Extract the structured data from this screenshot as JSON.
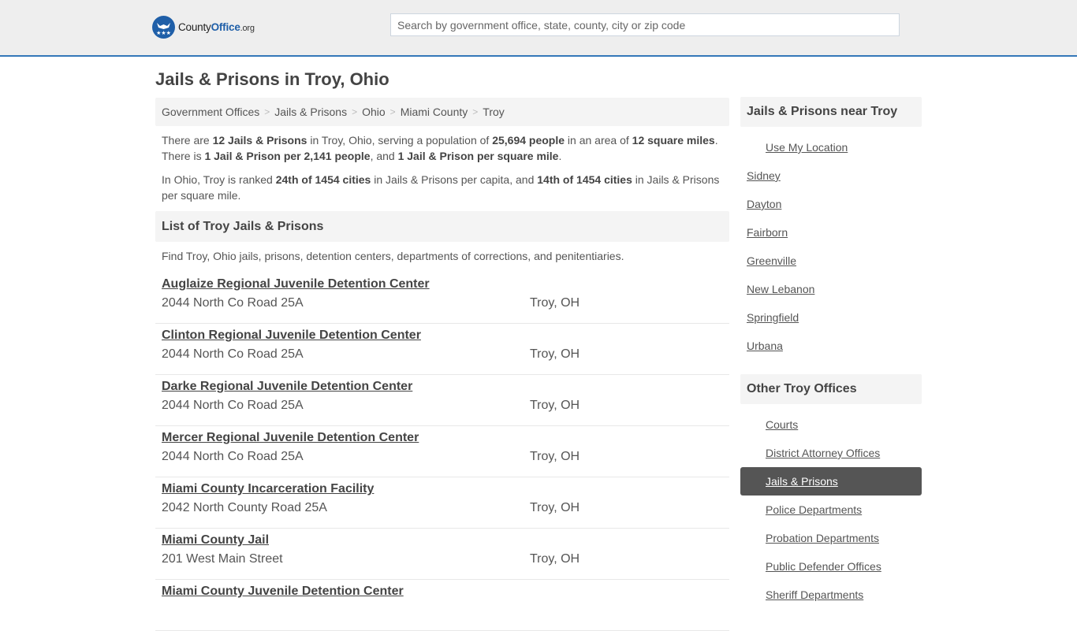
{
  "header": {
    "logo": {
      "name": "County",
      "office": "Office",
      "tld": ".org"
    },
    "search_placeholder": "Search by government office, state, county, city or zip code",
    "accent_color": "#3477b8"
  },
  "page_title": "Jails & Prisons in Troy, Ohio",
  "breadcrumb": [
    "Government Offices",
    "Jails & Prisons",
    "Ohio",
    "Miami County",
    "Troy"
  ],
  "breadcrumb_separator": ">",
  "intro": {
    "p1": {
      "t1": "There are ",
      "b1": "12 Jails & Prisons",
      "t2": " in Troy, Ohio, serving a population of ",
      "b2": "25,694 people",
      "t3": " in an area of ",
      "b3": "12 square miles",
      "t4": ". There is ",
      "b4": "1 Jail & Prison per 2,141 people",
      "t5": ", and ",
      "b5": "1 Jail & Prison per square mile",
      "t6": "."
    },
    "p2": {
      "t1": "In Ohio, Troy is ranked ",
      "b1": "24th of 1454 cities",
      "t2": " in Jails & Prisons per capita, and ",
      "b2": "14th of 1454 cities",
      "t3": " in Jails & Prisons per square mile."
    }
  },
  "list_section": {
    "title": "List of Troy Jails & Prisons",
    "description": "Find Troy, Ohio jails, prisons, detention centers, departments of corrections, and penitentiaries.",
    "items": [
      {
        "name": "Auglaize Regional Juvenile Detention Center",
        "address": "2044 North Co Road 25A",
        "city": "Troy, OH"
      },
      {
        "name": "Clinton Regional Juvenile Detention Center",
        "address": "2044 North Co Road 25A",
        "city": "Troy, OH"
      },
      {
        "name": "Darke Regional Juvenile Detention Center",
        "address": "2044 North Co Road 25A",
        "city": "Troy, OH"
      },
      {
        "name": "Mercer Regional Juvenile Detention Center",
        "address": "2044 North Co Road 25A",
        "city": "Troy, OH"
      },
      {
        "name": "Miami County Incarceration Facility",
        "address": "2042 North County Road 25A",
        "city": "Troy, OH"
      },
      {
        "name": "Miami County Jail",
        "address": "201 West Main Street",
        "city": "Troy, OH"
      },
      {
        "name": "Miami County Juvenile Detention Center",
        "address": "",
        "city": ""
      }
    ]
  },
  "sidebar": {
    "nearby": {
      "title": "Jails & Prisons near Troy",
      "use_location": "Use My Location",
      "cities": [
        "Sidney",
        "Dayton",
        "Fairborn",
        "Greenville",
        "New Lebanon",
        "Springfield",
        "Urbana"
      ]
    },
    "other": {
      "title": "Other Troy Offices",
      "items": [
        "Courts",
        "District Attorney Offices",
        "Jails & Prisons",
        "Police Departments",
        "Probation Departments",
        "Public Defender Offices",
        "Sheriff Departments"
      ],
      "active": "Jails & Prisons"
    }
  }
}
